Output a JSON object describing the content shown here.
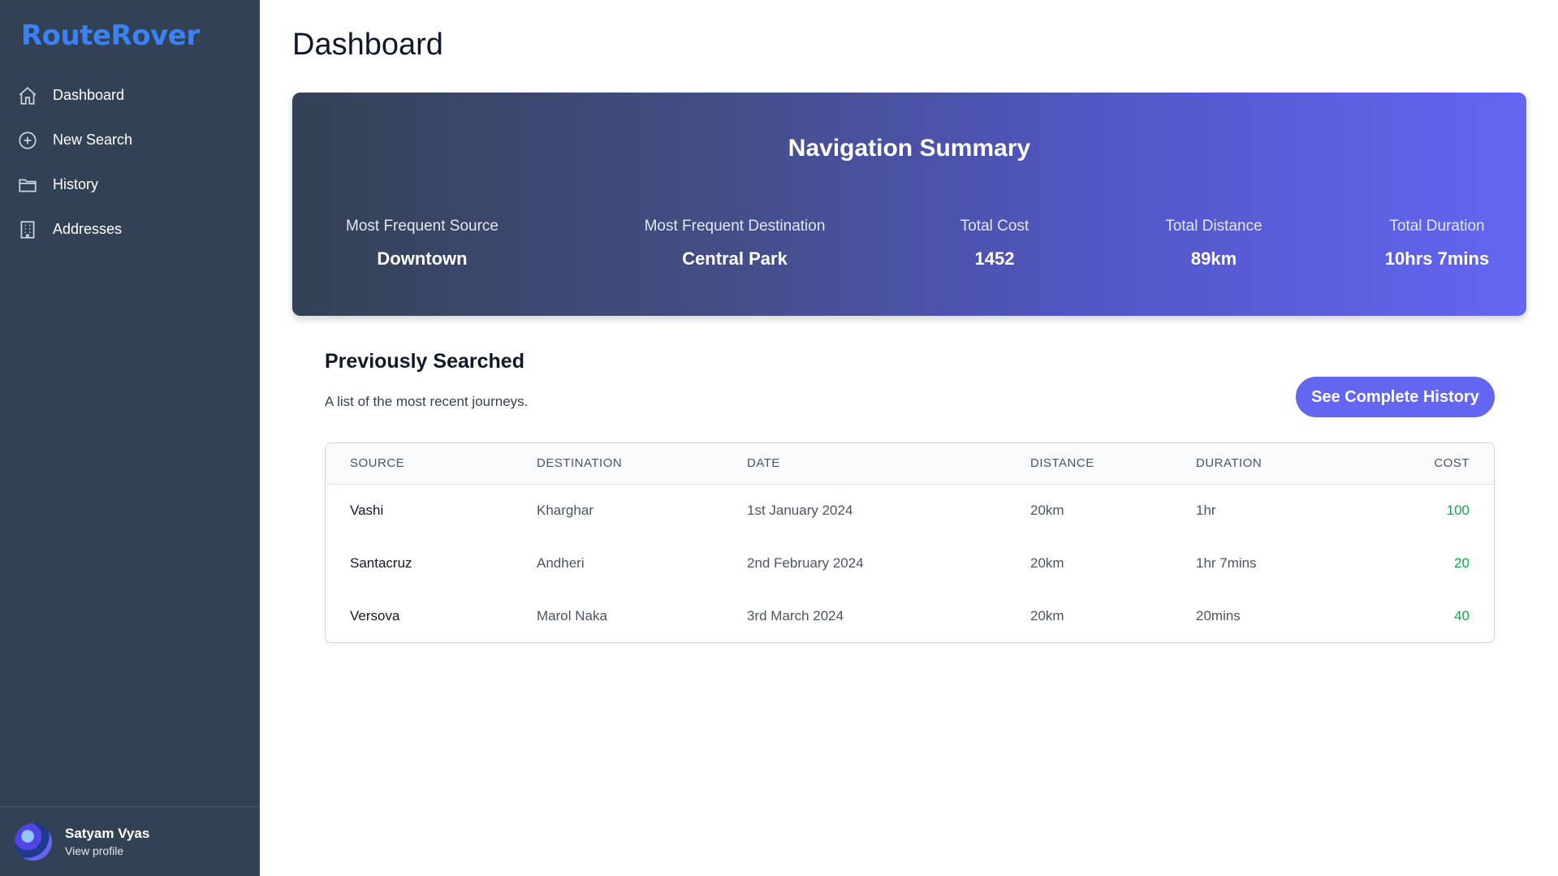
{
  "sidebar": {
    "brand": "RouteRover",
    "items": [
      {
        "label": "Dashboard",
        "icon": "home-icon"
      },
      {
        "label": "New Search",
        "icon": "plus-circle-icon"
      },
      {
        "label": "History",
        "icon": "folder-icon"
      },
      {
        "label": "Addresses",
        "icon": "building-icon"
      }
    ],
    "user": {
      "name": "Satyam Vyas",
      "link": "View profile"
    }
  },
  "main": {
    "title": "Dashboard",
    "summary": {
      "title": "Navigation Summary",
      "stats": [
        {
          "label": "Most Frequent Source",
          "value": "Downtown"
        },
        {
          "label": "Most Frequent Destination",
          "value": "Central Park"
        },
        {
          "label": "Total Cost",
          "value": "1452"
        },
        {
          "label": "Total Distance",
          "value": "89km"
        },
        {
          "label": "Total Duration",
          "value": "10hrs 7mins"
        }
      ]
    },
    "recent": {
      "title": "Previously Searched",
      "subtitle": "A list of the most recent journeys.",
      "button": "See Complete History",
      "columns": [
        "SOURCE",
        "DESTINATION",
        "DATE",
        "DISTANCE",
        "DURATION",
        "COST"
      ],
      "rows": [
        {
          "source": "Vashi",
          "destination": "Kharghar",
          "date": "1st January 2024",
          "distance": "20km",
          "duration": "1hr",
          "cost": "100"
        },
        {
          "source": "Santacruz",
          "destination": "Andheri",
          "date": "2nd February 2024",
          "distance": "20km",
          "duration": "1hr 7mins",
          "cost": "20"
        },
        {
          "source": "Versova",
          "destination": "Marol Naka",
          "date": "3rd March 2024",
          "distance": "20km",
          "duration": "20mins",
          "cost": "40"
        }
      ]
    }
  },
  "colors": {
    "sidebar_bg": "#334155",
    "brand": "#3b82f6",
    "accent": "#6366f1",
    "cost_green": "#16a34a"
  }
}
